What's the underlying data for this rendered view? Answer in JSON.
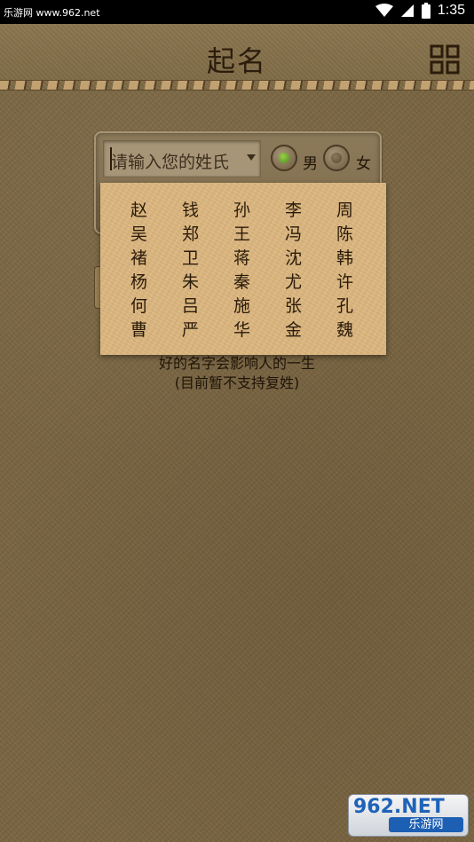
{
  "status_bar": {
    "site": "乐游网 www.962.net",
    "time": "1:35"
  },
  "header": {
    "title": "起名",
    "menu_icon": "grid-icon"
  },
  "form": {
    "surname_placeholder": "请输入您的姓氏",
    "gender_options": [
      {
        "label": "男",
        "selected": true
      },
      {
        "label": "女",
        "selected": false
      }
    ]
  },
  "hint": {
    "line1": "好的名字会影响人的一生",
    "line2": "(目前暂不支持复姓)"
  },
  "surname_dropdown": {
    "options": [
      "赵",
      "钱",
      "孙",
      "李",
      "周",
      "吴",
      "郑",
      "王",
      "冯",
      "陈",
      "褚",
      "卫",
      "蒋",
      "沈",
      "韩",
      "杨",
      "朱",
      "秦",
      "尤",
      "许",
      "何",
      "吕",
      "施",
      "张",
      "孔",
      "曹",
      "严",
      "华",
      "金",
      "魏"
    ]
  },
  "watermark": {
    "top": "962.NET",
    "bottom": "乐游网"
  },
  "colors": {
    "background": "#7b6642",
    "popup": "#dbb57d",
    "text": "#2a1b0a",
    "selected_radio": "#6aa82e"
  }
}
